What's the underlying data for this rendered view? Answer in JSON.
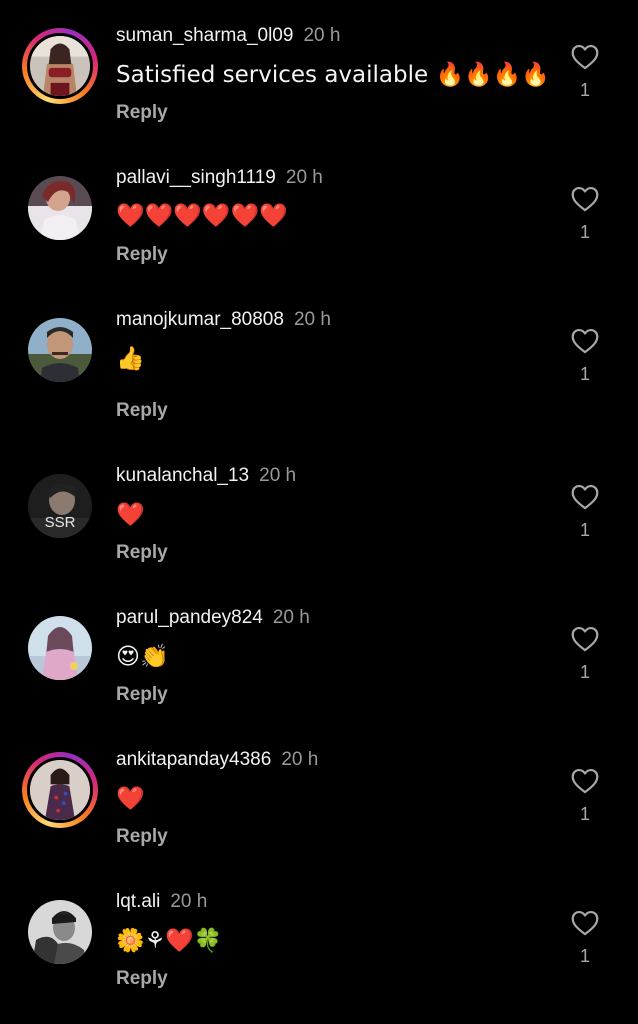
{
  "comments": [
    {
      "username": "suman_sharma_0l09",
      "time": "20 h",
      "text": "Satisfied services available 🔥🔥🔥🔥",
      "reply": "Reply",
      "likes": "1",
      "has_story": true
    },
    {
      "username": "pallavi__singh1119",
      "time": "20 h",
      "text": "❤️❤️❤️❤️❤️❤️",
      "reply": "Reply",
      "likes": "1",
      "has_story": false
    },
    {
      "username": "manojkumar_80808",
      "time": "20 h",
      "text": "👍",
      "reply": "Reply",
      "likes": "1",
      "has_story": false
    },
    {
      "username": "kunalanchal_13",
      "time": "20 h",
      "text": "❤️",
      "reply": "Reply",
      "likes": "1",
      "has_story": false,
      "avatar_text": "SSR"
    },
    {
      "username": "parul_pandey824",
      "time": "20 h",
      "text": "😍👏",
      "reply": "Reply",
      "likes": "1",
      "has_story": false
    },
    {
      "username": "ankitapanday4386",
      "time": "20 h",
      "text": "❤️",
      "reply": "Reply",
      "likes": "1",
      "has_story": true
    },
    {
      "username": "lqt.ali",
      "time": "20 h",
      "text": "🌼⚘❤️🍀",
      "reply": "Reply",
      "likes": "1",
      "has_story": false
    }
  ],
  "icons": {
    "like": "heart-outline-icon"
  },
  "colors": {
    "background": "#000000",
    "text": "#f5f5f5",
    "secondary": "#9a9a9a",
    "story_ring": [
      "#feda75",
      "#fa7e1e",
      "#d62976",
      "#962fbf"
    ]
  }
}
